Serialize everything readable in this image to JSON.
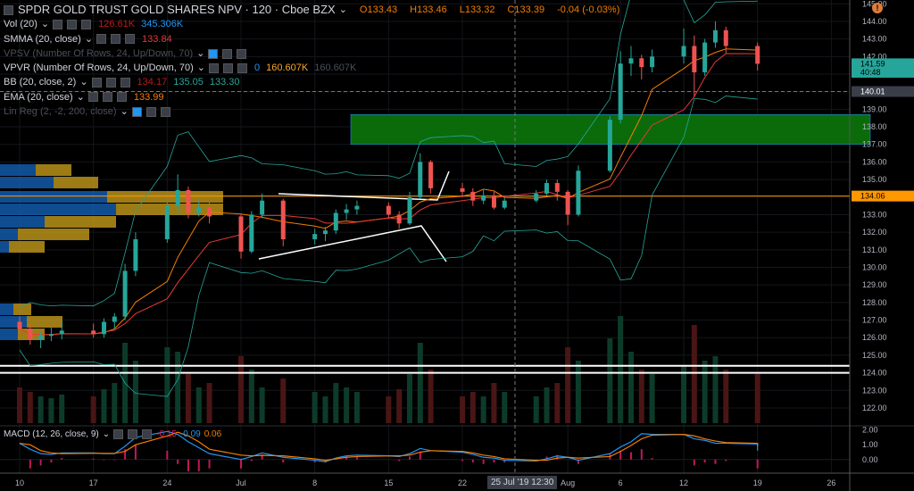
{
  "header": {
    "symbol": "SPDR GOLD TRUST GOLD SHARES NPV · 120 · Cboe BZX",
    "open": "O133.43",
    "high": "H133.46",
    "low": "L133.32",
    "close": "C133.39",
    "change": "-0.04 (-0.03%)"
  },
  "indicators": [
    {
      "label": "Vol (20)",
      "values": [
        "126.61K",
        "345.306K"
      ],
      "colors": [
        "#b71c1c",
        "#2196f3"
      ],
      "dim": false
    },
    {
      "label": "SMMA (20, close)",
      "values": [
        "133.84"
      ],
      "colors": [
        "#e53935"
      ],
      "dim": false
    },
    {
      "label": "VPSV (Number Of Rows, 24, Up/Down, 70)",
      "values": [],
      "colors": [],
      "dim": true
    },
    {
      "label": "VPVR (Number Of Rows, 24, Up/Down, 70)",
      "values": [
        "0",
        "160.607K",
        "160.607K"
      ],
      "colors": [
        "#2196f3",
        "#f9a825",
        "#4a4f5a"
      ],
      "dim": false
    },
    {
      "label": "BB (20, close, 2)",
      "values": [
        "134.17",
        "135.05",
        "133.30"
      ],
      "colors": [
        "#b71c1c",
        "#26a69a",
        "#26a69a"
      ],
      "dim": false
    },
    {
      "label": "EMA (20, close)",
      "values": [
        "133.99"
      ],
      "colors": [
        "#f57c00"
      ],
      "dim": false
    },
    {
      "label": "Lin Reg (2, -2, 200, close)",
      "values": [],
      "colors": [],
      "dim": true
    }
  ],
  "macd": {
    "label": "MACD (12, 26, close, 9)",
    "values": [
      "-0.15",
      "-0.09",
      "0.06"
    ],
    "colors": [
      "#e91e63",
      "#2196f3",
      "#f57c00"
    ]
  },
  "crosshair_label": "25 Jul '19  12:30",
  "colors": {
    "up": "#26a69a",
    "down": "#ef5350",
    "bb": "#26a69a",
    "ema": "#f57c00",
    "smma": "#e53935",
    "zone": "#0b6b0b",
    "hline": "#ff9800"
  },
  "chart_data": {
    "type": "candlestick",
    "title": "SPDR GOLD TRUST GOLD SHARES NPV",
    "interval": "120",
    "ylim": [
      121.5,
      145
    ],
    "y_ticks": [
      "145.00",
      "144.00",
      "143.00",
      "142.00",
      "141.00",
      "140.00",
      "139.00",
      "138.00",
      "137.00",
      "136.00",
      "135.00",
      "134.00",
      "133.00",
      "132.00",
      "131.00",
      "130.00",
      "129.00",
      "128.00",
      "127.00",
      "126.00",
      "125.00",
      "124.00",
      "123.00",
      "122.00"
    ],
    "x_ticks": [
      {
        "date": "2019-06-10",
        "label": "10"
      },
      {
        "date": "2019-06-17",
        "label": "17"
      },
      {
        "date": "2019-06-24",
        "label": "24"
      },
      {
        "date": "2019-07-01",
        "label": "Jul"
      },
      {
        "date": "2019-07-08",
        "label": "8"
      },
      {
        "date": "2019-07-15",
        "label": "15"
      },
      {
        "date": "2019-07-22",
        "label": "22"
      },
      {
        "date": "2019-08-01",
        "label": "Aug"
      },
      {
        "date": "2019-08-06",
        "label": "6"
      },
      {
        "date": "2019-08-12",
        "label": "12"
      },
      {
        "date": "2019-08-19",
        "label": "19"
      },
      {
        "date": "2019-08-26",
        "label": "26"
      }
    ],
    "price_labels": [
      {
        "value": 141.59,
        "text": "141.59",
        "color": "#26a69a"
      },
      {
        "value": 141.1,
        "text": "40:48",
        "color": "#26a69a"
      },
      {
        "value": 140.01,
        "text": "140.01",
        "color": "#3a3e48"
      },
      {
        "value": 134.06,
        "text": "134.06",
        "color": "#ff9800"
      }
    ],
    "horizontal_lines": [
      134.06,
      124.4,
      124.0
    ],
    "zone": {
      "from": "2019-07-31",
      "to": "2019-08-23",
      "low": 137.0,
      "high": 138.7
    },
    "candles": [
      [
        "2019-06-10",
        126.9,
        127.2,
        126.2,
        126.5
      ],
      [
        "2019-06-11",
        126.5,
        126.8,
        125.6,
        125.9
      ],
      [
        "2019-06-12",
        125.9,
        126.3,
        125.4,
        126.1
      ],
      [
        "2019-06-13",
        126.1,
        126.6,
        125.8,
        126.2
      ],
      [
        "2019-06-14",
        126.2,
        126.9,
        125.9,
        126.4
      ],
      [
        "2019-06-17",
        126.4,
        126.8,
        126.0,
        126.2
      ],
      [
        "2019-06-18",
        126.2,
        127.1,
        126.0,
        126.9
      ],
      [
        "2019-06-19",
        126.9,
        127.4,
        126.5,
        127.2
      ],
      [
        "2019-06-20",
        127.2,
        130.2,
        127.0,
        129.8
      ],
      [
        "2019-06-21",
        129.8,
        132.0,
        129.5,
        131.6
      ],
      [
        "2019-06-24",
        131.6,
        133.8,
        131.4,
        133.5
      ],
      [
        "2019-06-25",
        133.5,
        135.3,
        133.0,
        134.4
      ],
      [
        "2019-06-26",
        134.4,
        134.6,
        132.8,
        133.1
      ],
      [
        "2019-06-27",
        133.1,
        133.8,
        132.9,
        133.4
      ],
      [
        "2019-06-28",
        133.4,
        133.7,
        132.5,
        132.9
      ],
      [
        "2019-07-01",
        132.9,
        133.0,
        130.5,
        130.9
      ],
      [
        "2019-07-02",
        130.9,
        133.2,
        130.8,
        133.0
      ],
      [
        "2019-07-03",
        133.0,
        134.2,
        132.8,
        133.8
      ],
      [
        "2019-07-05",
        133.8,
        133.9,
        131.2,
        131.6
      ],
      [
        "2019-07-08",
        131.6,
        132.2,
        131.3,
        131.9
      ],
      [
        "2019-07-09",
        131.9,
        132.3,
        131.5,
        132.1
      ],
      [
        "2019-07-10",
        132.1,
        133.3,
        131.9,
        133.1
      ],
      [
        "2019-07-11",
        133.1,
        133.6,
        132.7,
        133.3
      ],
      [
        "2019-07-12",
        133.3,
        133.8,
        133.0,
        133.5
      ],
      [
        "2019-07-15",
        133.5,
        133.7,
        132.8,
        133.0
      ],
      [
        "2019-07-16",
        133.0,
        133.2,
        132.2,
        132.5
      ],
      [
        "2019-07-17",
        132.5,
        134.3,
        132.4,
        134.0
      ],
      [
        "2019-07-18",
        134.0,
        136.5,
        133.9,
        136.0
      ],
      [
        "2019-07-19",
        136.0,
        136.1,
        134.2,
        134.5
      ],
      [
        "2019-07-22",
        134.5,
        134.8,
        134.0,
        134.3
      ],
      [
        "2019-07-23",
        134.3,
        134.5,
        133.5,
        133.8
      ],
      [
        "2019-07-24",
        133.8,
        134.4,
        133.6,
        134.1
      ],
      [
        "2019-07-25",
        134.1,
        134.3,
        133.3,
        133.4
      ],
      [
        "2019-07-26",
        133.4,
        134.0,
        133.3,
        133.8
      ],
      [
        "2019-07-29",
        133.8,
        134.4,
        133.7,
        134.2
      ],
      [
        "2019-07-30",
        134.2,
        135.0,
        134.1,
        134.8
      ],
      [
        "2019-07-31",
        134.8,
        135.0,
        133.8,
        134.3
      ],
      [
        "2019-08-01",
        134.3,
        134.4,
        132.4,
        133.0
      ],
      [
        "2019-08-02",
        133.0,
        135.8,
        132.9,
        135.5
      ],
      [
        "2019-08-05",
        135.5,
        138.6,
        135.4,
        138.4
      ],
      [
        "2019-08-06",
        138.4,
        142.3,
        138.2,
        141.6
      ],
      [
        "2019-08-07",
        141.6,
        142.6,
        140.9,
        141.9
      ],
      [
        "2019-08-08",
        141.9,
        142.1,
        140.7,
        141.4
      ],
      [
        "2019-08-09",
        141.4,
        142.4,
        141.1,
        142.0
      ],
      [
        "2019-08-12",
        142.0,
        143.6,
        141.6,
        142.6
      ],
      [
        "2019-08-13",
        142.6,
        143.2,
        139.7,
        141.1
      ],
      [
        "2019-08-14",
        141.1,
        143.0,
        140.9,
        142.8
      ],
      [
        "2019-08-15",
        142.8,
        144.0,
        142.5,
        143.5
      ],
      [
        "2019-08-16",
        143.5,
        143.7,
        142.2,
        142.6
      ],
      [
        "2019-08-19",
        142.6,
        142.8,
        141.2,
        141.59
      ]
    ],
    "volume": [
      40,
      35,
      30,
      28,
      32,
      30,
      38,
      45,
      90,
      70,
      85,
      80,
      55,
      40,
      45,
      75,
      60,
      40,
      50,
      35,
      30,
      45,
      40,
      35,
      30,
      38,
      55,
      90,
      60,
      30,
      35,
      30,
      45,
      35,
      30,
      40,
      45,
      85,
      70,
      95,
      120,
      80,
      60,
      55,
      65,
      110,
      70,
      75,
      60,
      55
    ],
    "macd": [
      1.1,
      0.7,
      0.4,
      0.35,
      0.45,
      0.45,
      0.4,
      0.4,
      0.9,
      1.5,
      1.9,
      1.7,
      1.2,
      0.8,
      0.4,
      0.0,
      0.2,
      0.45,
      0.15,
      -0.05,
      -0.15,
      0.1,
      0.25,
      0.3,
      0.25,
      0.2,
      0.4,
      0.75,
      0.6,
      0.5,
      0.35,
      0.15,
      0.1,
      -0.05,
      -0.1,
      0.05,
      0.25,
      0.15,
      -0.05,
      0.4,
      0.85,
      1.2,
      1.75,
      1.7,
      1.7,
      1.4,
      1.3,
      1.1,
      1.1,
      1.05,
      0.6
    ],
    "signal": [
      1.1,
      1.0,
      0.6,
      0.45,
      0.4,
      0.42,
      0.42,
      0.42,
      0.55,
      1.0,
      1.6,
      1.85,
      1.6,
      1.2,
      0.7,
      0.3,
      0.25,
      0.28,
      0.25,
      0.05,
      -0.05,
      0.05,
      0.15,
      0.2,
      0.25,
      0.25,
      0.3,
      0.5,
      0.6,
      0.55,
      0.45,
      0.3,
      0.2,
      0.05,
      -0.05,
      -0.05,
      0.1,
      0.15,
      0.1,
      0.2,
      0.55,
      0.95,
      1.4,
      1.65,
      1.7,
      1.6,
      1.4,
      1.25,
      1.15,
      1.1,
      0.9
    ],
    "macd_ylim": [
      -0.8,
      2.1
    ],
    "macd_ticks": [
      "2.00",
      "1.00",
      "0.00"
    ]
  }
}
